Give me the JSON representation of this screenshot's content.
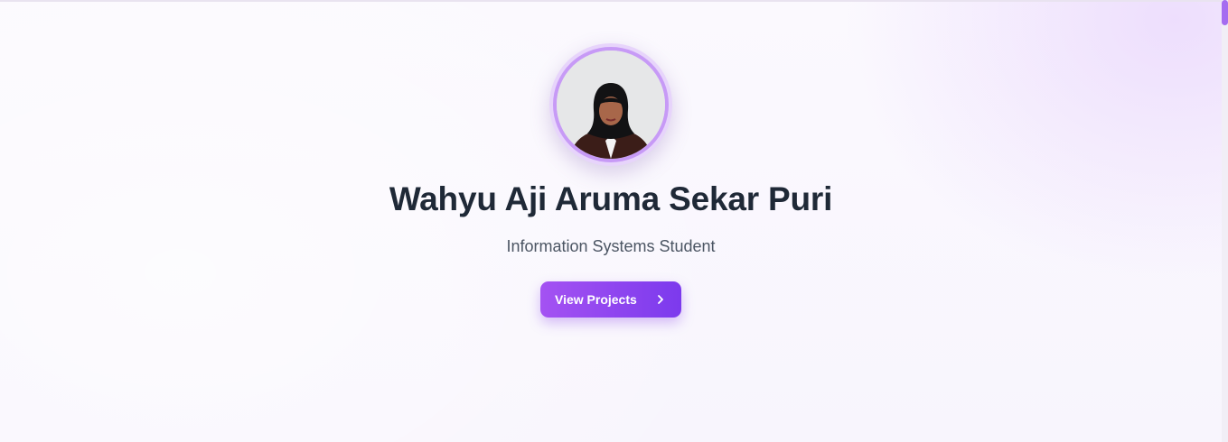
{
  "profile": {
    "name": "Wahyu Aji Aruma Sekar Puri",
    "role": "Information Systems Student",
    "avatar_icon": "profile-photo"
  },
  "cta": {
    "label": "View Projects",
    "icon": "chevron-right-icon"
  },
  "colors": {
    "accent_start": "#a452f2",
    "accent_end": "#7c3aed",
    "heading": "#1f2937",
    "subtitle": "#4b5563",
    "ring": "#c79af6"
  }
}
